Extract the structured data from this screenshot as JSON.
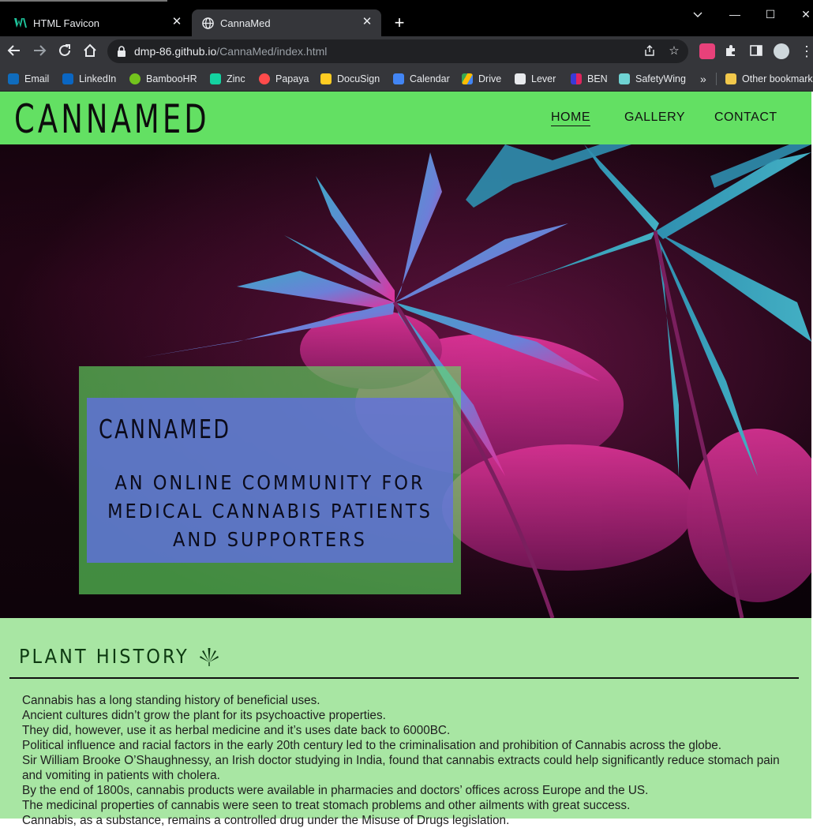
{
  "browser": {
    "tabs": [
      {
        "title": "HTML Favicon",
        "icon": "w-logo-icon"
      },
      {
        "title": "CannaMed",
        "icon": "globe-icon",
        "active": true
      }
    ],
    "url_host": "dmp-86.github.io",
    "url_path": "/CannaMed/index.html",
    "bookmarks": [
      {
        "label": "Email",
        "icon": "outlook-icon",
        "color": "#0f6cbd"
      },
      {
        "label": "LinkedIn",
        "icon": "linkedin-icon",
        "color": "#0a66c2"
      },
      {
        "label": "BambooHR",
        "icon": "bamboohr-icon",
        "color": "#73c41d"
      },
      {
        "label": "Zinc",
        "icon": "zinc-icon",
        "color": "#14d3a1"
      },
      {
        "label": "Papaya",
        "icon": "papaya-icon",
        "color": "#ff4b4b"
      },
      {
        "label": "DocuSign",
        "icon": "docusign-icon",
        "color": "#ffcc22"
      },
      {
        "label": "Calendar",
        "icon": "calendar-icon",
        "color": "#4285f4"
      },
      {
        "label": "Drive",
        "icon": "drive-icon",
        "color": "#34a853"
      },
      {
        "label": "Lever",
        "icon": "lever-icon",
        "color": "#ffffff"
      },
      {
        "label": "BEN",
        "icon": "ben-icon",
        "color": "#e0245e"
      },
      {
        "label": "SafetyWing",
        "icon": "safetywing-icon",
        "color": "#6fd3d3"
      }
    ],
    "more_bookmarks": "»",
    "other_bookmarks": "Other bookmarks"
  },
  "site": {
    "logo": "CANNAMED",
    "nav": [
      "HOME",
      "GALLERY",
      "CONTACT"
    ],
    "active_nav": "HOME",
    "accent_color": "#63e063",
    "hero": {
      "title": "CANNAMED",
      "subtitle": "AN ONLINE COMMUNITY FOR MEDICAL CANNABIS PATIENTS AND SUPPORTERS"
    },
    "history": {
      "heading": "PLANT HISTORY",
      "heading_icon": "cannabis-leaf-icon",
      "paragraphs": [
        "Cannabis has a long standing history of beneficial uses.",
        "Ancient cultures didn’t grow the plant for its psychoactive properties.",
        "They did, however, use it as herbal medicine and it’s uses date back to 6000BC.",
        "Political influence and racial factors in the early 20th century led to the criminalisation and prohibition of Cannabis across the globe.",
        "Sir William Brooke O’Shaughnessy, an Irish doctor studying in India, found that cannabis extracts could help significantly reduce stomach pain and vomiting in patients with cholera.",
        "By the end of 1800s, cannabis products were available in pharmacies and doctors’ offices across Europe and the US.",
        "The medicinal properties of cannabis were seen to treat stomach problems and other ailments with great success.",
        "Cannabis, as a substance, remains a controlled drug under the Misuse of Drugs legislation."
      ]
    }
  }
}
